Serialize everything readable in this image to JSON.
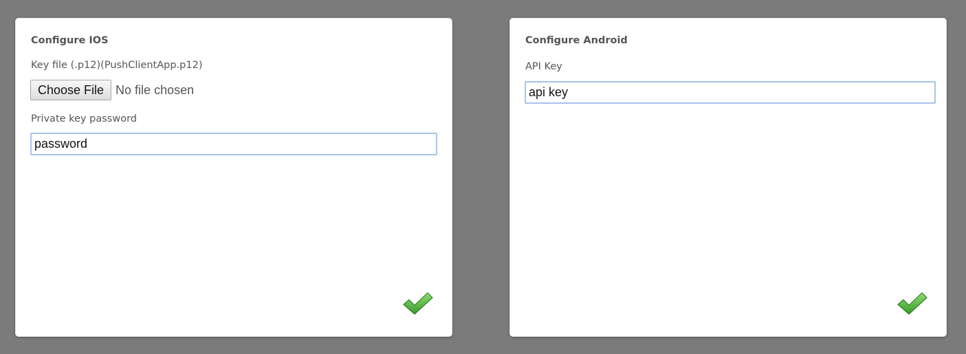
{
  "ios": {
    "title": "Configure IOS",
    "key_file_label": "Key file (.p12)(PushClientApp.p12)",
    "choose_file_label": "Choose File",
    "file_status": "No file chosen",
    "password_label": "Private key password",
    "password_value": "password",
    "confirm_icon": "checkmark-icon"
  },
  "android": {
    "title": "Configure Android",
    "api_key_label": "API Key",
    "api_key_value": "api key",
    "confirm_icon": "checkmark-icon"
  },
  "colors": {
    "background": "#7b7b7b",
    "panel": "#ffffff",
    "label_text": "#555555",
    "input_focus_border": "#a7c3ea",
    "check_green": "#4cae3a"
  }
}
